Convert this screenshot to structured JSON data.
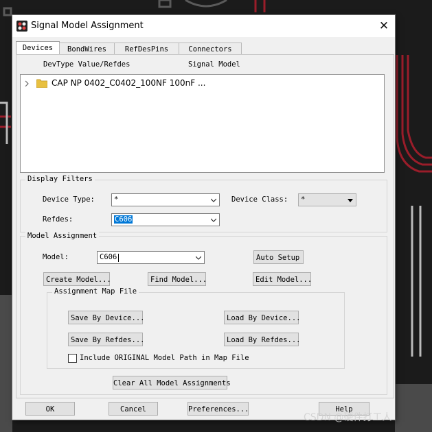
{
  "window": {
    "title": "Signal Model Assignment",
    "close_glyph": "✕"
  },
  "tabs": [
    {
      "label": "Devices"
    },
    {
      "label": "BondWires"
    },
    {
      "label": "RefDesPins"
    },
    {
      "label": "Connectors"
    }
  ],
  "device_list": {
    "col_devtype": "DevType Value/Refdes",
    "col_signal_model": "Signal Model",
    "rows": [
      {
        "label": "CAP NP 0402_C0402_100NF 100nF ..."
      }
    ]
  },
  "display_filters": {
    "title": "Display Filters",
    "device_type_label": "Device Type:",
    "device_type_value": "*",
    "device_class_label": "Device Class:",
    "device_class_value": "*",
    "refdes_label": "Refdes:",
    "refdes_value": "C606"
  },
  "model_assignment": {
    "title": "Model Assignment",
    "model_label": "Model:",
    "model_value": "C606",
    "auto_setup": "Auto Setup",
    "create_model": "Create Model...",
    "find_model": "Find Model...",
    "edit_model": "Edit Model...",
    "map_file": {
      "title": "Assignment Map File",
      "save_by_device": "Save By Device...",
      "load_by_device": "Load By Device...",
      "save_by_refdes": "Save By Refdes...",
      "load_by_refdes": "Load By Refdes...",
      "include_path_label": "Include ORIGINAL Model Path in Map File",
      "include_path_checked": false
    },
    "clear_all": "Clear All Model Assignments"
  },
  "footer": {
    "ok": "OK",
    "cancel": "Cancel",
    "preferences": "Preferences...",
    "help": "Help"
  },
  "watermark": "CSDN @硬件打工人",
  "colors": {
    "selection": "#0078d7",
    "folder": "#e8c040",
    "trace_red": "#b01c2e"
  }
}
